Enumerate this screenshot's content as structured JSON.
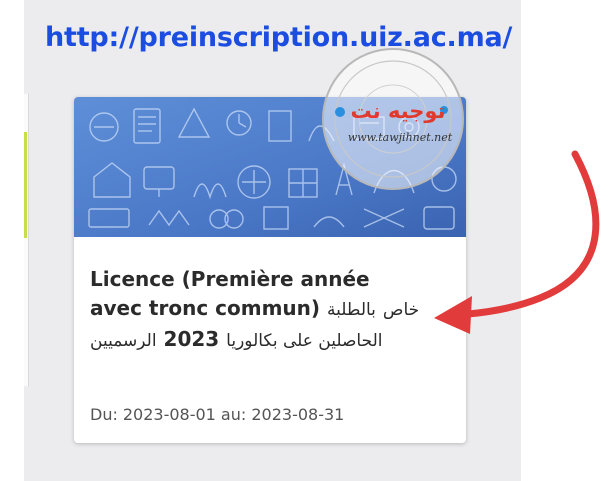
{
  "page": {
    "url_heading": "http://preinscription.uiz.ac.ma/"
  },
  "card": {
    "title_line1": "Licence (Première année",
    "title_line2_fr": "avec tronc commun)",
    "title_ar_1": "خاص",
    "title_ar_2": "بالطلبة الحاصلين على بكالوريا",
    "title_year": "2023",
    "title_ar_3": "الرسميين",
    "date_prefix": "Du:",
    "date_value": "2023-08-01 au: 2023-08-31"
  },
  "watermark": {
    "brand_ar": "توجيه نت",
    "site": "www.tawjihnet.net"
  },
  "colors": {
    "url_blue": "#1b4de0",
    "banner_blue": "#4a78c7",
    "arrow_red": "#e23b3b",
    "accent_green": "#c7dd4a"
  },
  "icons": {
    "banner": "education-doodle-pattern",
    "arrow": "curved-arrow-pointing-left"
  }
}
